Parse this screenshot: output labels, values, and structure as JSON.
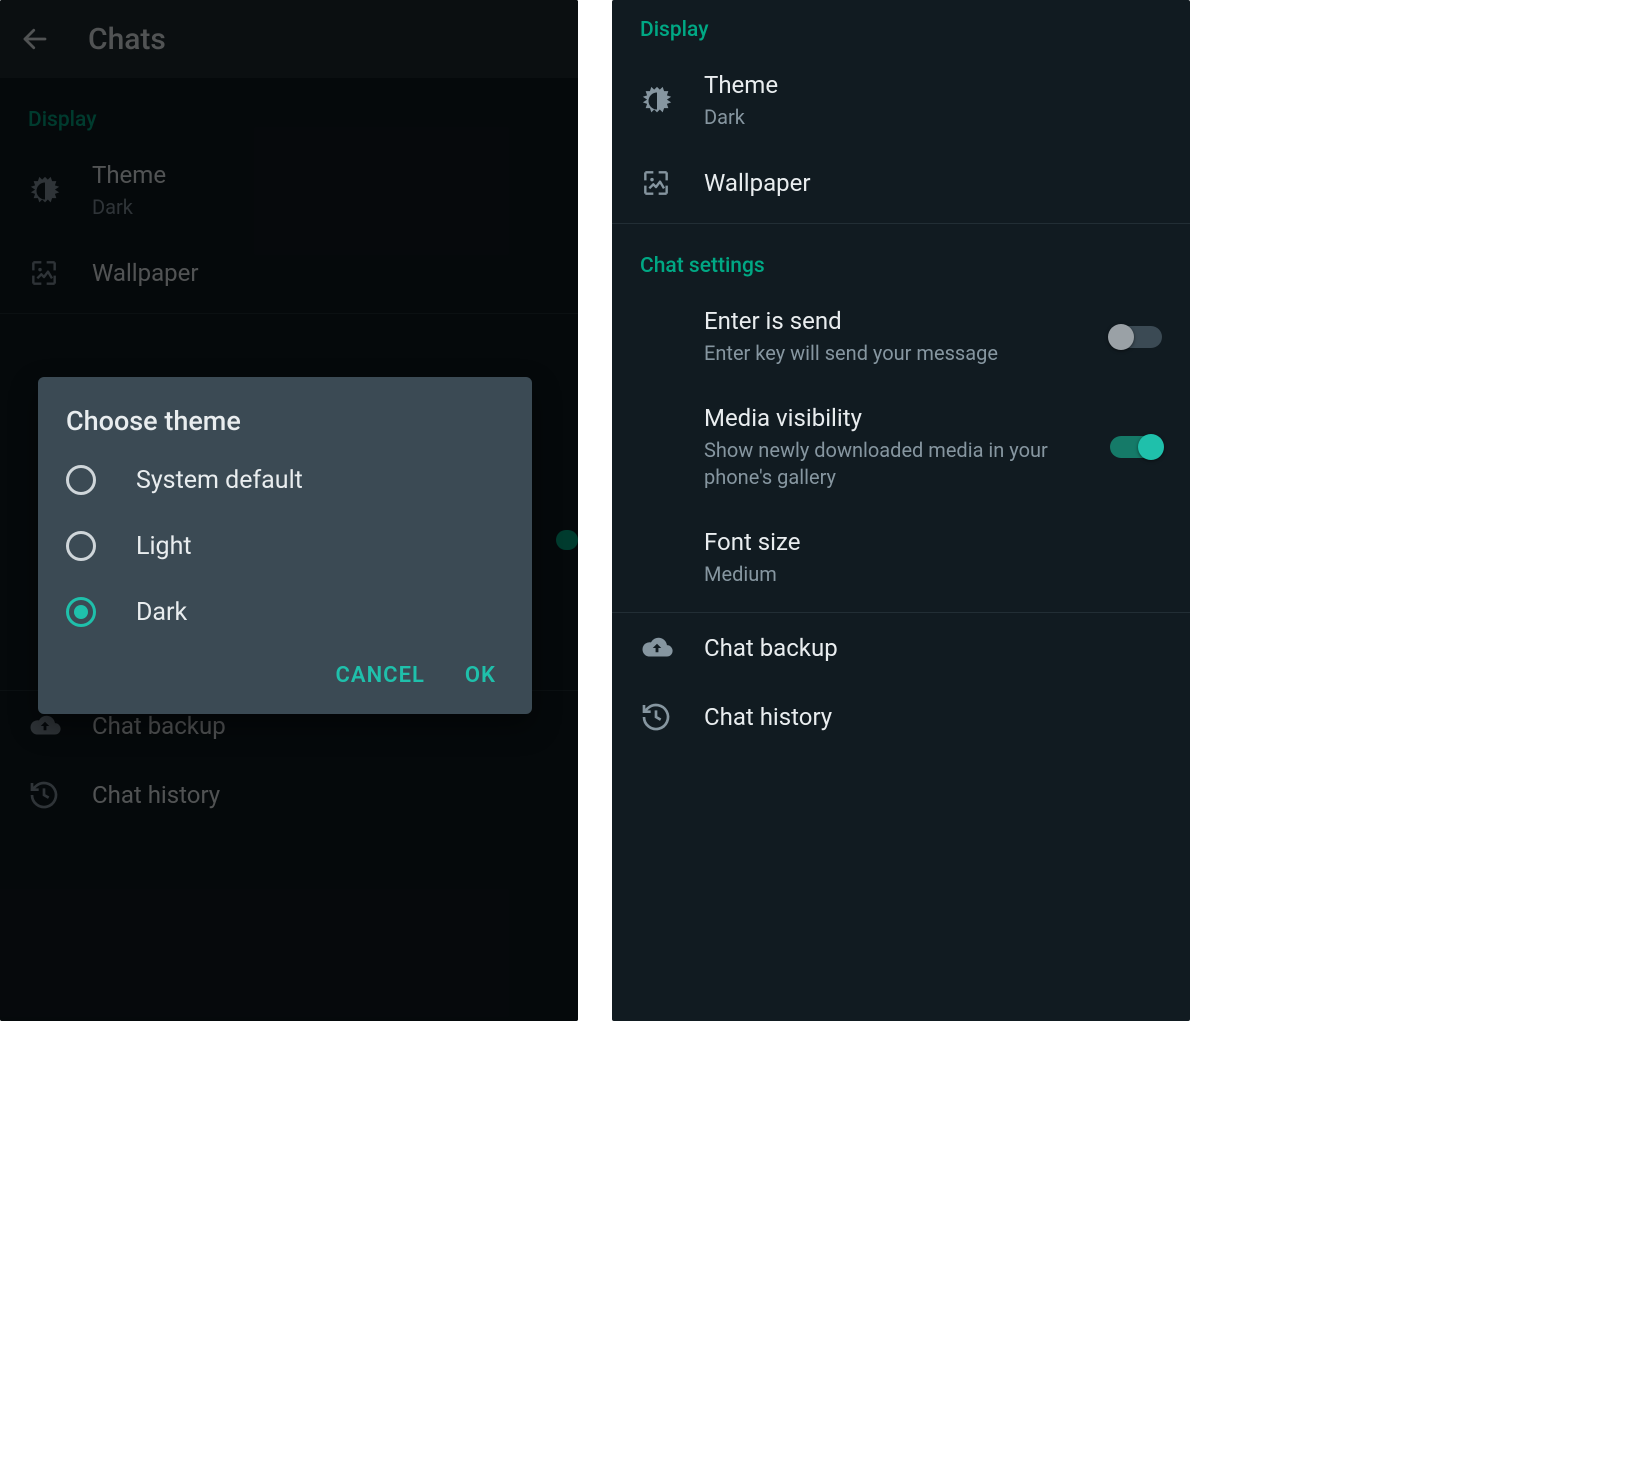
{
  "left": {
    "header": {
      "title": "Chats"
    },
    "display": {
      "label": "Display",
      "theme": {
        "title": "Theme",
        "value": "Dark"
      },
      "wallpaper": {
        "title": "Wallpaper"
      }
    },
    "bottom": {
      "chat_backup": "Chat backup",
      "chat_history": "Chat history"
    },
    "dialog": {
      "title": "Choose theme",
      "options": {
        "system": "System default",
        "light": "Light",
        "dark": "Dark"
      },
      "selected": "dark",
      "cancel": "CANCEL",
      "ok": "OK"
    }
  },
  "right": {
    "display": {
      "label": "Display",
      "theme": {
        "title": "Theme",
        "value": "Dark"
      },
      "wallpaper": {
        "title": "Wallpaper"
      }
    },
    "chat_settings": {
      "label": "Chat settings",
      "enter_is_send": {
        "title": "Enter is send",
        "sub": "Enter key will send your message",
        "on": false
      },
      "media_visibility": {
        "title": "Media visibility",
        "sub": "Show newly downloaded media in your phone's gallery",
        "on": true
      },
      "font_size": {
        "title": "Font size",
        "value": "Medium"
      }
    },
    "bottom": {
      "chat_backup": "Chat backup",
      "chat_history": "Chat history"
    }
  }
}
